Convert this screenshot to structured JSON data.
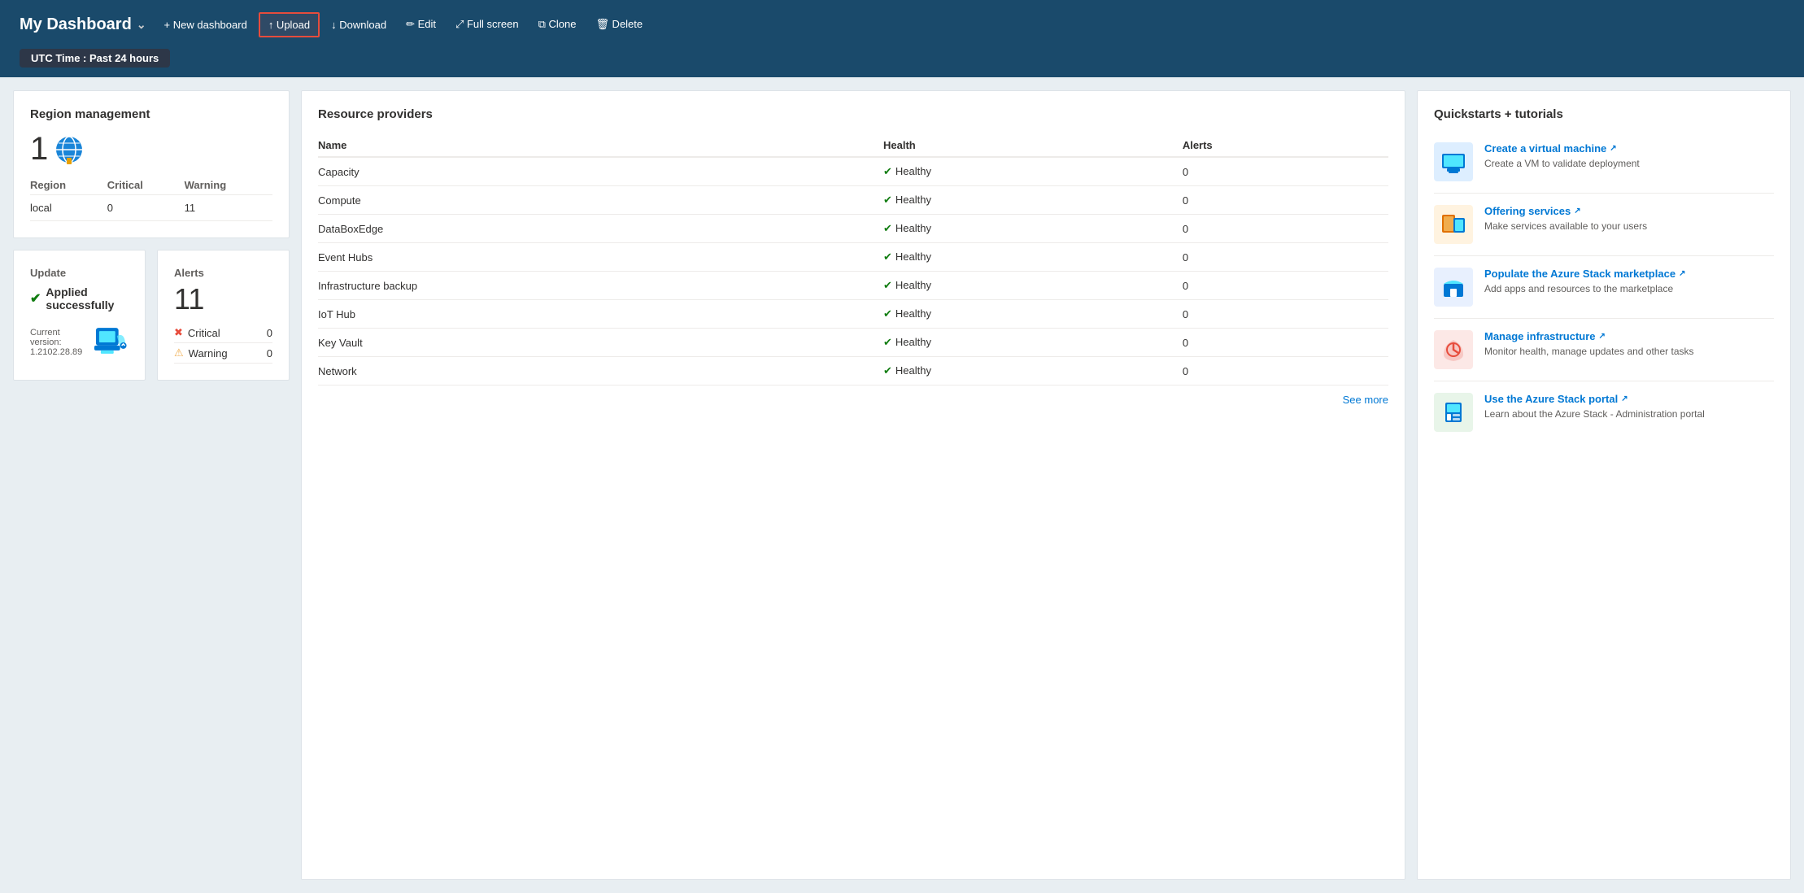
{
  "header": {
    "title": "My Dashboard",
    "buttons": {
      "new_dashboard": "+ New dashboard",
      "upload": "↑ Upload",
      "download": "↓ Download",
      "edit": "✏ Edit",
      "fullscreen": "⤢ Full screen",
      "clone": "⧉ Clone",
      "delete": "🗑 Delete"
    }
  },
  "time_bar": {
    "label": "UTC Time :",
    "value": "Past 24 hours"
  },
  "region_management": {
    "title": "Region management",
    "count": "1",
    "columns": [
      "Region",
      "Critical",
      "Warning"
    ],
    "rows": [
      {
        "region": "local",
        "critical": "0",
        "warning": "11"
      }
    ]
  },
  "update": {
    "label": "Update",
    "status": "Applied successfully",
    "version_label": "Current version:",
    "version": "1.2102.28.89"
  },
  "alerts": {
    "label": "Alerts",
    "count": "11",
    "items": [
      {
        "icon": "critical",
        "label": "Critical",
        "count": "0"
      },
      {
        "icon": "warning",
        "label": "Warning",
        "count": "0"
      }
    ]
  },
  "resource_providers": {
    "title": "Resource providers",
    "columns": [
      "Name",
      "Health",
      "Alerts"
    ],
    "rows": [
      {
        "name": "Capacity",
        "health": "Healthy",
        "alerts": "0"
      },
      {
        "name": "Compute",
        "health": "Healthy",
        "alerts": "0"
      },
      {
        "name": "DataBoxEdge",
        "health": "Healthy",
        "alerts": "0"
      },
      {
        "name": "Event Hubs",
        "health": "Healthy",
        "alerts": "0"
      },
      {
        "name": "Infrastructure backup",
        "health": "Healthy",
        "alerts": "0"
      },
      {
        "name": "IoT Hub",
        "health": "Healthy",
        "alerts": "0"
      },
      {
        "name": "Key Vault",
        "health": "Healthy",
        "alerts": "0"
      },
      {
        "name": "Network",
        "health": "Healthy",
        "alerts": "0"
      }
    ],
    "see_more": "See more"
  },
  "quickstarts": {
    "title": "Quickstarts + tutorials",
    "items": [
      {
        "id": "vm",
        "title": "Create a virtual machine",
        "desc": "Create a VM to validate deployment",
        "icon_color": "#ddeeff",
        "icon_char": "🖥"
      },
      {
        "id": "offering",
        "title": "Offering services",
        "desc": "Make services available to your users",
        "icon_color": "#fff3e0",
        "icon_char": "🎫"
      },
      {
        "id": "marketplace",
        "title": "Populate the Azure Stack marketplace",
        "desc": "Add apps and resources to the marketplace",
        "icon_color": "#e8f0fe",
        "icon_char": "🏪"
      },
      {
        "id": "infra",
        "title": "Manage infrastructure",
        "desc": "Monitor health, manage updates and other tasks",
        "icon_color": "#fce8e6",
        "icon_char": "❤"
      },
      {
        "id": "portal",
        "title": "Use the Azure Stack portal",
        "desc": "Learn about the Azure Stack - Administration portal",
        "icon_color": "#e8f5e9",
        "icon_char": "🏢"
      }
    ]
  }
}
